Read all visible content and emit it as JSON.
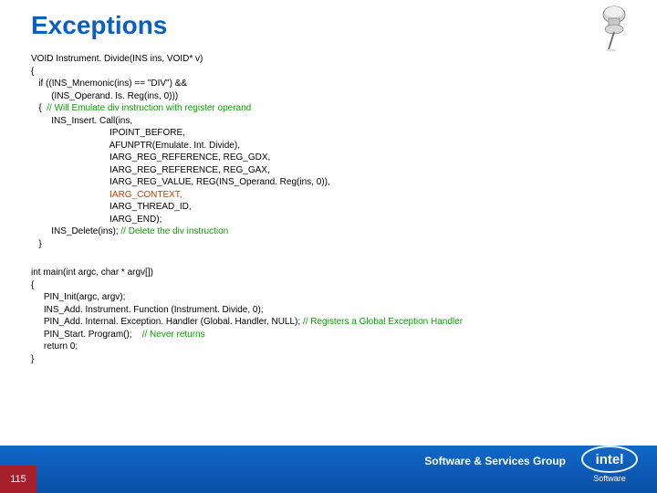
{
  "title": "Exceptions",
  "code": {
    "l1": "VOID Instrument. Divide(INS ins, VOID* v)",
    "l2": "{",
    "l3": "   if ((INS_Mnemonic(ins) == \"DIV\") &&",
    "l4": "        (INS_Operand. Is. Reg(ins, 0)))",
    "l5a": "   {  ",
    "l5b": "// Will Emulate div instruction with register operand",
    "l6": "        INS_Insert. Call(ins,",
    "l7": "                               IPOINT_BEFORE,",
    "l8": "                               AFUNPTR(Emulate. Int. Divide),",
    "l9": "                               IARG_REG_REFERENCE, REG_GDX,",
    "l10": "                               IARG_REG_REFERENCE, REG_GAX,",
    "l11": "                               IARG_REG_VALUE, REG(INS_Operand. Reg(ins, 0)),",
    "l12": "                               IARG_CONTEXT,",
    "l13": "                               IARG_THREAD_ID,",
    "l14": "                               IARG_END);",
    "l15a": "        INS_Delete(ins); ",
    "l15b": "// Delete the div instruction",
    "l16": "   }",
    "m1": "int main(int argc, char * argv[])",
    "m2": "{",
    "m3": "     PIN_Init(argc, argv);",
    "m4": "     INS_Add. Instrument. Function (Instrument. Divide, 0);",
    "m5a": "     PIN_Add. Internal. Exception. Handler (Global. Handler, NULL); ",
    "m5b": "// Registers a Global Exception Handler",
    "m6a": "     PIN_Start. Program();    ",
    "m6b": "// Never returns",
    "m7": "     return 0;",
    "m8": "}"
  },
  "footer": {
    "label": "Software & Services Group",
    "page": "115",
    "brand": "intel",
    "sub": "Software"
  }
}
